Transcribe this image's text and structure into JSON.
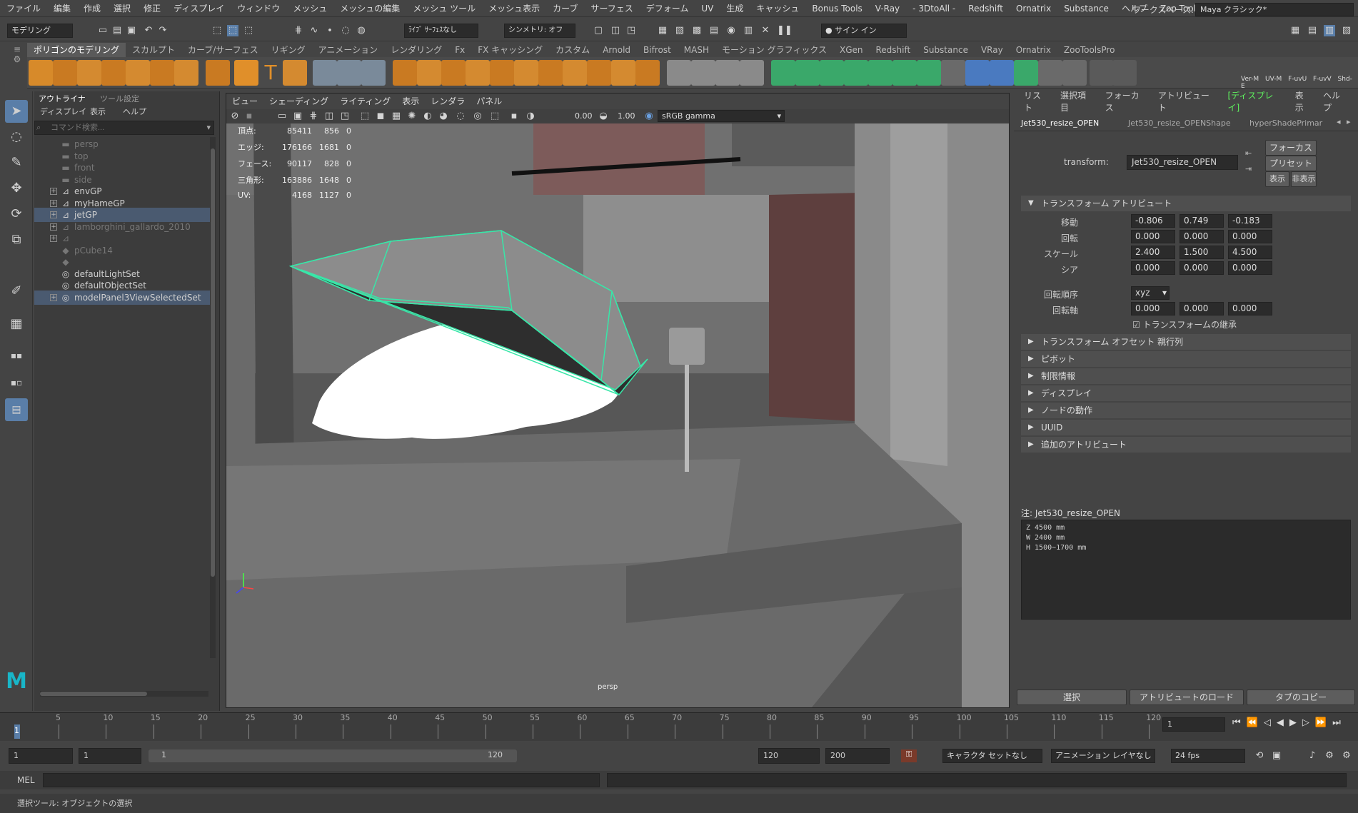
{
  "menubar": {
    "items": [
      "ファイル",
      "編集",
      "作成",
      "選択",
      "修正",
      "ディスプレイ",
      "ウィンドウ",
      "メッシュ",
      "メッシュの編集",
      "メッシュ ツール",
      "メッシュ表示",
      "カーブ",
      "サーフェス",
      "デフォーム",
      "UV",
      "生成",
      "キャッシュ",
      "Bonus Tools",
      "V-Ray",
      "- 3DtoAll -",
      "Redshift",
      "Ornatrix",
      "Substance",
      "ヘルプ",
      "Zoo Tools"
    ],
    "workspace_label": "ワークスペース:",
    "workspace_value": "Maya クラシック*"
  },
  "statusline": {
    "mode": "モデリング",
    "live_surface": "ﾗｲﾌﾞ ｻｰﾌｪｽなし",
    "symmetry": "シンメトリ: オフ",
    "sign_in": "サイン イン"
  },
  "shelf": {
    "tabs": [
      "ポリゴンのモデリング",
      "スカルプト",
      "カーブ/サーフェス",
      "リギング",
      "アニメーション",
      "レンダリング",
      "Fx",
      "FX キャッシング",
      "カスタム",
      "Arnold",
      "Bifrost",
      "MASH",
      "モーション グラフィックス",
      "XGen",
      "Redshift",
      "Substance",
      "VRay",
      "Ornatrix",
      "ZooToolsPro"
    ],
    "active_tab": 0,
    "labels": [
      "Ver-M",
      "UV-M",
      "F-uvU",
      "F-uvV",
      "Shd-E"
    ]
  },
  "outliner": {
    "tabs": [
      "アウトライナ",
      "ツール設定"
    ],
    "menus": [
      "ディスプレイ",
      "表示",
      "ヘルプ"
    ],
    "search_placeholder": "コマンド検索...",
    "items": [
      {
        "label": "persp",
        "icon": "camera-icon",
        "dim": true,
        "expand": false
      },
      {
        "label": "top",
        "icon": "camera-icon",
        "dim": true,
        "expand": false
      },
      {
        "label": "front",
        "icon": "camera-icon",
        "dim": true,
        "expand": false
      },
      {
        "label": "side",
        "icon": "camera-icon",
        "dim": true,
        "expand": false
      },
      {
        "label": "envGP",
        "icon": "group-icon",
        "dim": false,
        "expand": true
      },
      {
        "label": "myHameGP",
        "icon": "group-icon",
        "dim": false,
        "expand": true
      },
      {
        "label": "jetGP",
        "icon": "group-icon",
        "dim": false,
        "expand": true,
        "selected": true
      },
      {
        "label": "lamborghini_gallardo_2010",
        "icon": "group-icon",
        "dim": true,
        "expand": true
      },
      {
        "label": "",
        "icon": "group-icon",
        "dim": true,
        "expand": true
      },
      {
        "label": "pCube14",
        "icon": "mesh-icon",
        "dim": true,
        "expand": false
      },
      {
        "label": "",
        "icon": "mesh-icon",
        "dim": true,
        "expand": false
      },
      {
        "label": "defaultLightSet",
        "icon": "set-icon",
        "dim": false,
        "expand": false
      },
      {
        "label": "defaultObjectSet",
        "icon": "set-icon",
        "dim": false,
        "expand": false
      },
      {
        "label": "modelPanel3ViewSelectedSet",
        "icon": "set-icon",
        "dim": false,
        "expand": true,
        "selected": true
      }
    ]
  },
  "viewport": {
    "menus": [
      "ビュー",
      "シェーディング",
      "ライティング",
      "表示",
      "レンダラ",
      "パネル"
    ],
    "exposure": "0.00",
    "gamma": "1.00",
    "color_space": "sRGB gamma",
    "camera_label": "persp",
    "hud": [
      {
        "label": "頂点:",
        "a": "85411",
        "b": "856",
        "c": "0"
      },
      {
        "label": "エッジ:",
        "a": "176166",
        "b": "1681",
        "c": "0"
      },
      {
        "label": "フェース:",
        "a": "90117",
        "b": "828",
        "c": "0"
      },
      {
        "label": "三角形:",
        "a": "163886",
        "b": "1648",
        "c": "0"
      },
      {
        "label": "UV:",
        "a": "4168",
        "b": "1127",
        "c": "0"
      }
    ],
    "colors": {
      "wire": "#38e6a8",
      "wall": "#8a8a8a",
      "floor": "#6a6a6a",
      "door": "#5e3f3e",
      "car": "#ffffff"
    }
  },
  "attribute_editor": {
    "menus": [
      "リスト",
      "選択項目",
      "フォーカス",
      "アトリビュート",
      "[ディスプレイ]",
      "表示",
      "ヘルプ"
    ],
    "tabs": [
      "Jet530_resize_OPEN",
      "Jet530_resize_OPENShape",
      "hyperShadePrimar"
    ],
    "transform_label": "transform:",
    "transform_value": "Jet530_resize_OPEN",
    "buttons": {
      "focus": "フォーカス",
      "preset": "プリセット",
      "show": "表示",
      "hide": "非表示"
    },
    "section_transform": "トランスフォーム アトリビュート",
    "fields": [
      {
        "label": "移動",
        "values": [
          "-0.806",
          "0.749",
          "-0.183"
        ]
      },
      {
        "label": "回転",
        "values": [
          "0.000",
          "0.000",
          "0.000"
        ]
      },
      {
        "label": "スケール",
        "values": [
          "2.400",
          "1.500",
          "4.500"
        ]
      },
      {
        "label": "シア",
        "values": [
          "0.000",
          "0.000",
          "0.000"
        ]
      }
    ],
    "rotate_order_label": "回転順序",
    "rotate_order": "xyz",
    "rotate_axis_label": "回転軸",
    "rotate_axis": [
      "0.000",
      "0.000",
      "0.000"
    ],
    "inherit_label": "トランスフォームの継承",
    "collapsed_sections": [
      "トランスフォーム オフセット 親行列",
      "ピボット",
      "制限情報",
      "ディスプレイ",
      "ノードの動作",
      "UUID",
      "追加のアトリビュート"
    ],
    "notes_title": "注:  Jet530_resize_OPEN",
    "notes_lines": [
      "Z 4500 mm",
      "W 2400 mm",
      "H 1500~1700 mm"
    ],
    "bottom_buttons": [
      "選択",
      "アトリビュートのロード",
      "タブのコピー"
    ]
  },
  "timeline": {
    "ticks": [
      "5",
      "10",
      "15",
      "20",
      "25",
      "30",
      "35",
      "40",
      "45",
      "50",
      "55",
      "60",
      "65",
      "70",
      "75",
      "80",
      "85",
      "90",
      "95",
      "100",
      "105",
      "110",
      "115",
      "120"
    ],
    "current_frame": "1",
    "frame_field": "1"
  },
  "range": {
    "start": "1",
    "playback_start": "1",
    "slider_start": "1",
    "slider_end": "120",
    "playback_end": "120",
    "end": "200",
    "character_set": "キャラクタ セットなし",
    "anim_layer": "アニメーション レイヤなし",
    "fps": "24 fps"
  },
  "mel": {
    "label": "MEL"
  },
  "help_line": "選択ツール: オブジェクトの選択"
}
